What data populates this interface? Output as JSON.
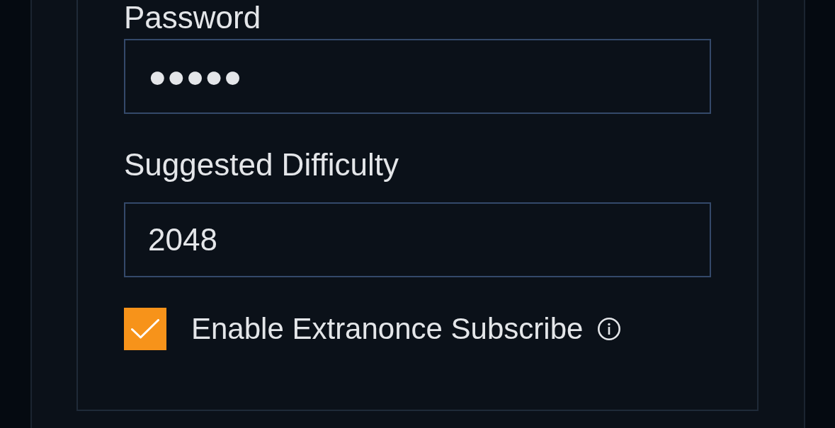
{
  "fields": [
    {
      "label": "Password",
      "value": "●●●●●"
    },
    {
      "label": "Suggested Difficulty",
      "value": "2048"
    }
  ],
  "checkbox": {
    "label": "Enable Extranonce Subscribe",
    "checked": true
  }
}
